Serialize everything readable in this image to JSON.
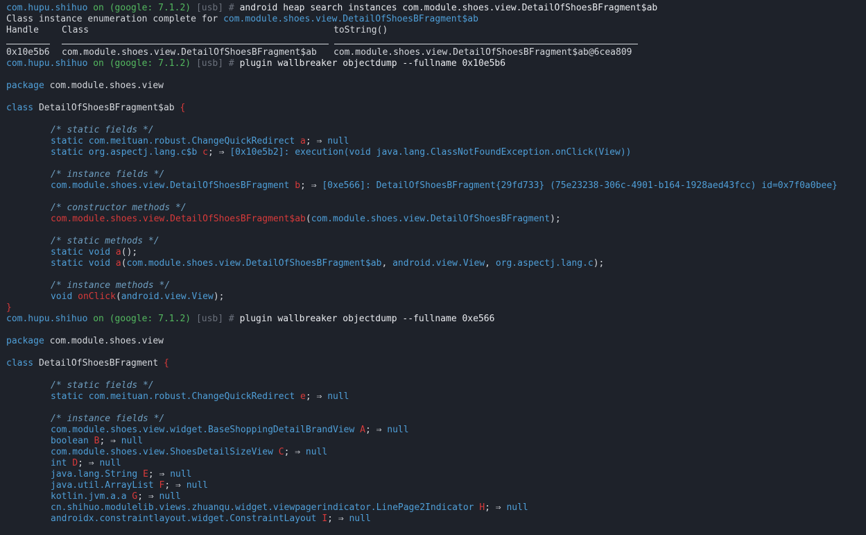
{
  "prompt": {
    "app": "com.hupu.shihuo",
    "on": "on",
    "device": "(google: 7.1.2)",
    "transport": "[usb]",
    "hash": "#"
  },
  "cmd1": "android heap search instances com.module.shoes.view.DetailOfShoesBFragment$ab",
  "enum_complete": "Class instance enumeration complete for ",
  "enum_class": "com.module.shoes.view.DetailOfShoesBFragment$ab",
  "table": {
    "headers": [
      "Handle",
      "Class",
      "toString()"
    ],
    "row": [
      "0x10e5b6",
      "com.module.shoes.view.DetailOfShoesBFragment$ab",
      "com.module.shoes.view.DetailOfShoesBFragment$ab@6cea809"
    ]
  },
  "cmd2": "plugin wallbreaker objectdump --fullname 0x10e5b6",
  "dump1": {
    "kw_package": "package",
    "package": "com.module.shoes.view",
    "kw_class": "class",
    "class_name": "DetailOfShoesBFragment$ab",
    "brace_open": "{",
    "brace_close": "}",
    "c_static_fields": "/* static fields */",
    "sf1_kw": "static",
    "sf1_type": "com.meituan.robust.ChangeQuickRedirect",
    "sf1_name": "a",
    "sf1_val": "null",
    "sf2_kw": "static",
    "sf2_type": "org.aspectj.lang.c$b",
    "sf2_name": "c",
    "sf2_val": "[0x10e5b2]: execution(void java.lang.ClassNotFoundException.onClick(View))",
    "c_instance_fields": "/* instance fields */",
    "if1_type": "com.module.shoes.view.DetailOfShoesBFragment",
    "if1_name": "b",
    "if1_val": "[0xe566]: DetailOfShoesBFragment{29fd733} (75e23238-306c-4901-b164-1928aed43fcc) id=0x7f0a0bee}",
    "c_constructor": "/* constructor methods */",
    "ctor_name": "com.module.shoes.view.DetailOfShoesBFragment$ab",
    "ctor_args": "com.module.shoes.view.DetailOfShoesBFragment",
    "c_static_methods": "/* static methods */",
    "sm1_kw": "static void",
    "sm1_name": "a",
    "sm2_kw": "static void",
    "sm2_name": "a",
    "sm2_arg1": "com.module.shoes.view.DetailOfShoesBFragment$ab",
    "sm2_arg2": "android.view.View",
    "sm2_arg3": "org.aspectj.lang.c",
    "c_instance_methods": "/* instance methods */",
    "im1_kw": "void",
    "im1_name": "onClick",
    "im1_arg": "android.view.View"
  },
  "cmd3": "plugin wallbreaker objectdump --fullname 0xe566",
  "dump2": {
    "kw_package": "package",
    "package": "com.module.shoes.view",
    "kw_class": "class",
    "class_name": "DetailOfShoesBFragment",
    "brace_open": "{",
    "c_static_fields": "/* static fields */",
    "sf1_kw": "static",
    "sf1_type": "com.meituan.robust.ChangeQuickRedirect",
    "sf1_name": "e",
    "sf1_val": "null",
    "c_instance_fields": "/* instance fields */",
    "fields": [
      {
        "type": "com.module.shoes.view.widget.BaseShoppingDetailBrandView",
        "name": "A",
        "val": "null"
      },
      {
        "type": "boolean",
        "name": "B",
        "val": "null"
      },
      {
        "type": "com.module.shoes.view.ShoesDetailSizeView",
        "name": "C",
        "val": "null"
      },
      {
        "type": "int",
        "name": "D",
        "val": "null"
      },
      {
        "type": "java.lang.String",
        "name": "E",
        "val": "null"
      },
      {
        "type": "java.util.ArrayList",
        "name": "F",
        "val": "null"
      },
      {
        "type": "kotlin.jvm.a.a",
        "name": "G",
        "val": "null"
      },
      {
        "type": "cn.shihuo.modulelib.views.zhuanqu.widget.viewpagerindicator.LinePage2Indicator",
        "name": "H",
        "val": "null"
      },
      {
        "type": "androidx.constraintlayout.widget.ConstraintLayout",
        "name": "I",
        "val": "null"
      }
    ]
  },
  "arrow": "⇒"
}
